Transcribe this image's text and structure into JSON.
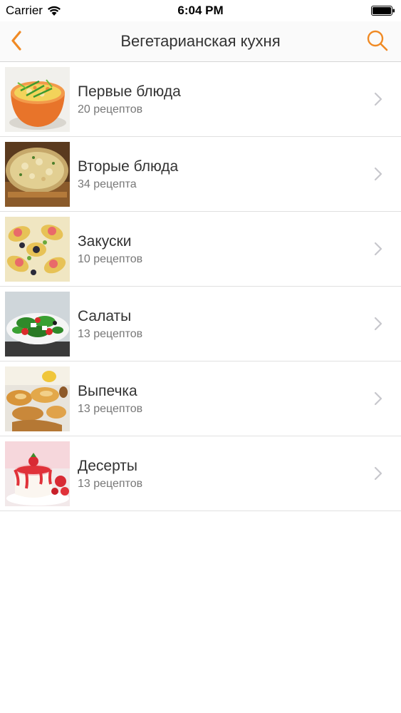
{
  "status_bar": {
    "carrier": "Carrier",
    "time": "6:04 PM"
  },
  "nav": {
    "title": "Вегетарианская кухня",
    "back_icon": "chevron-left-icon",
    "search_icon": "search-icon",
    "accent_color": "#f08a24"
  },
  "categories": [
    {
      "title": "Первые блюда",
      "count": "20 рецептов"
    },
    {
      "title": "Вторые блюда",
      "count": "34 рецепта"
    },
    {
      "title": "Закуски",
      "count": "10 рецептов"
    },
    {
      "title": "Салаты",
      "count": "13 рецептов"
    },
    {
      "title": "Выпечка",
      "count": "13 рецептов"
    },
    {
      "title": "Десерты",
      "count": "13 рецептов"
    }
  ]
}
